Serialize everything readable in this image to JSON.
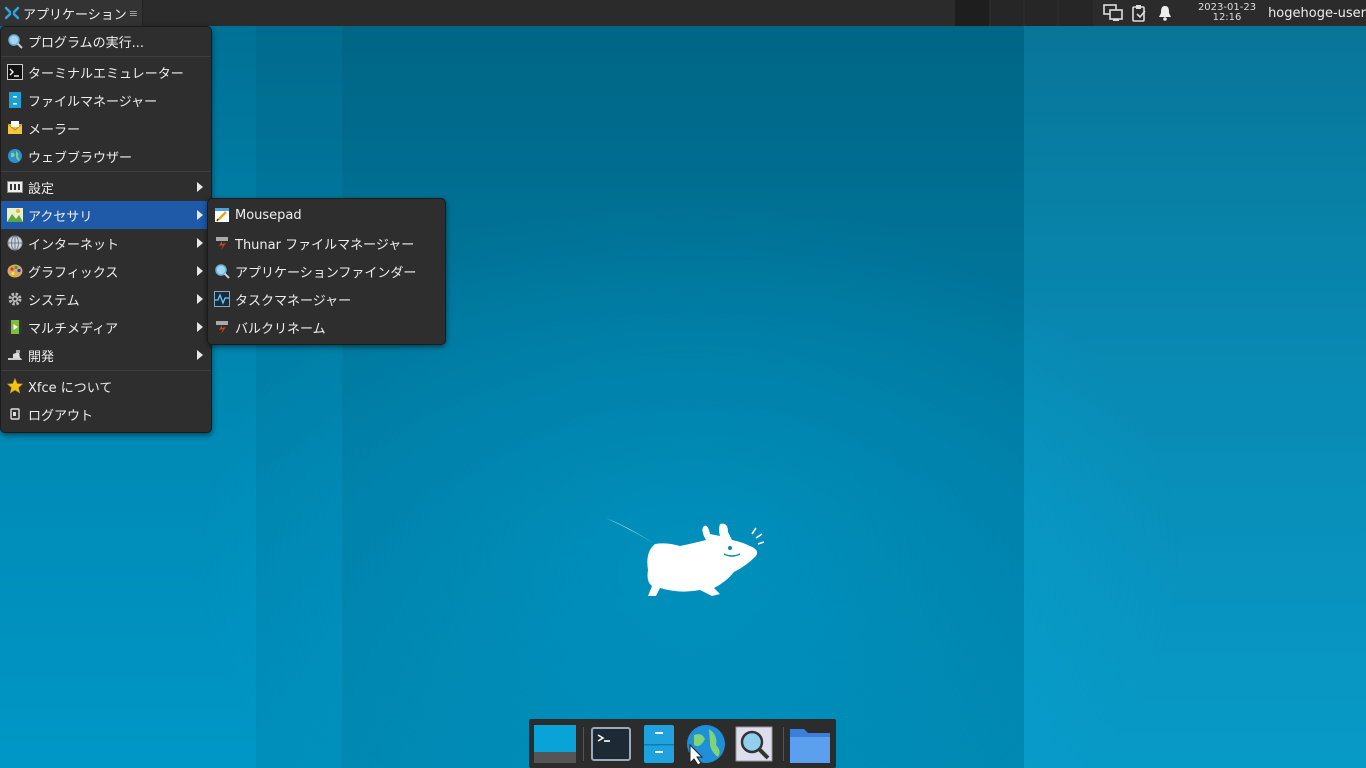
{
  "panel": {
    "applications_label": "アプリケーション",
    "clock_date": "2023-01-23",
    "clock_time": "12:16",
    "username": "hogehoge-user"
  },
  "main_menu": {
    "items": [
      {
        "label": "プログラムの実行...",
        "icon": "search-icon"
      },
      {
        "label": "ターミナルエミュレーター",
        "icon": "terminal-icon"
      },
      {
        "label": "ファイルマネージャー",
        "icon": "file-manager-icon"
      },
      {
        "label": "メーラー",
        "icon": "mail-icon"
      },
      {
        "label": "ウェブブラウザー",
        "icon": "web-browser-icon"
      },
      {
        "label": "設定",
        "icon": "settings-icon"
      },
      {
        "label": "アクセサリ",
        "icon": "accessories-icon"
      },
      {
        "label": "インターネット",
        "icon": "internet-icon"
      },
      {
        "label": "グラフィックス",
        "icon": "graphics-icon"
      },
      {
        "label": "システム",
        "icon": "system-gear-icon"
      },
      {
        "label": "マルチメディア",
        "icon": "multimedia-icon"
      },
      {
        "label": "開発",
        "icon": "development-icon"
      },
      {
        "label": "Xfce について",
        "icon": "star-icon"
      },
      {
        "label": "ログアウト",
        "icon": "logout-icon"
      }
    ],
    "selected": "アクセサリ"
  },
  "submenu": {
    "items": [
      {
        "label": "Mousepad",
        "icon": "mousepad-icon"
      },
      {
        "label": "Thunar ファイルマネージャー",
        "icon": "thunar-icon"
      },
      {
        "label": "アプリケーションファインダー",
        "icon": "appfinder-icon"
      },
      {
        "label": "タスクマネージャー",
        "icon": "task-manager-icon"
      },
      {
        "label": "バルクリネーム",
        "icon": "bulk-rename-icon"
      }
    ]
  },
  "dock": {
    "items": [
      "show-desktop-icon",
      "terminal-icon",
      "file-manager-icon",
      "web-browser-icon",
      "appfinder-icon",
      "folder-icon"
    ]
  },
  "colors": {
    "panel_bg": "#2b2b2b",
    "menu_bg": "#2e2e2e",
    "selection": "#1e5aa7",
    "desktop": "#0090c0"
  }
}
